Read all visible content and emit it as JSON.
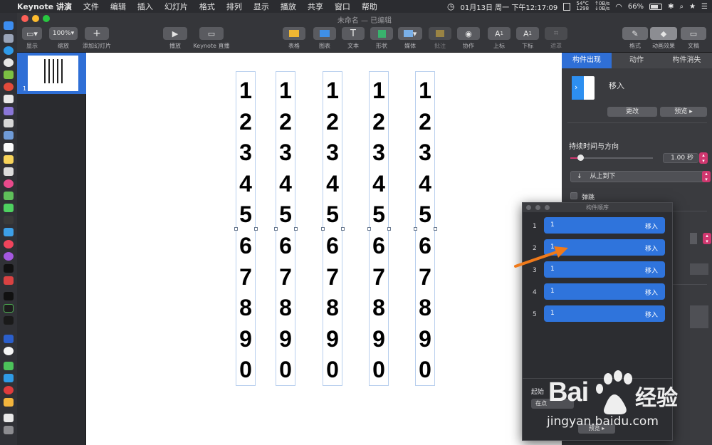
{
  "menubar": {
    "apple": "",
    "app_name": "Keynote 讲演",
    "items": [
      "文件",
      "编辑",
      "插入",
      "幻灯片",
      "格式",
      "排列",
      "显示",
      "播放",
      "共享",
      "窗口",
      "帮助"
    ],
    "clock": "01月13日 周一 下午12:17:09",
    "temp": "54°C",
    "rpm": "1298",
    "net_up": "0B/s",
    "net_down": "0B/s",
    "battery": "66%"
  },
  "window": {
    "title": "未命名 — 已编辑"
  },
  "toolbar": {
    "view": "显示",
    "zoom_value": "100%",
    "zoom": "缩放",
    "add_slide": "添加幻灯片",
    "play": "播放",
    "live": "Keynote 直播",
    "table": "表格",
    "chart": "图表",
    "text": "文本",
    "shape": "形状",
    "media": "媒体",
    "comment": "批注",
    "collaborate": "协作",
    "superscript": "上标",
    "subscript": "下标",
    "mask": "遮罩",
    "format": "格式",
    "animate": "动画效果",
    "document": "文稿"
  },
  "navigator": {
    "slide_number": "1"
  },
  "canvas": {
    "digits": [
      "1",
      "2",
      "3",
      "4",
      "5",
      "6",
      "7",
      "8",
      "9",
      "0"
    ]
  },
  "inspector": {
    "tabs": [
      "构件出现",
      "动作",
      "构件消失"
    ],
    "effect_name": "移入",
    "change": "更改",
    "preview": "预览",
    "duration_label": "持续时间与方向",
    "duration_value": "1.00 秒",
    "duration_fraction": 0.12,
    "direction": "从上到下",
    "bounce": "弹跳"
  },
  "build_order": {
    "title": "构件顺序",
    "rows": [
      {
        "num": "1",
        "label": "1",
        "effect": "移入"
      },
      {
        "num": "2",
        "label": "1",
        "effect": "移入"
      },
      {
        "num": "3",
        "label": "1",
        "effect": "移入"
      },
      {
        "num": "4",
        "label": "1",
        "effect": "移入"
      },
      {
        "num": "5",
        "label": "1",
        "effect": "移入"
      }
    ],
    "start_label": "起始",
    "start_value": "在点",
    "preview": "预览"
  },
  "watermark": {
    "line1": "Bai",
    "line2": "经验",
    "url": "jingyan.baidu.com"
  },
  "colors": {
    "accent": "#2f6fd6",
    "build_row": "#2f74dc",
    "stepper": "#d0376f",
    "arrow": "#f07a1a"
  }
}
